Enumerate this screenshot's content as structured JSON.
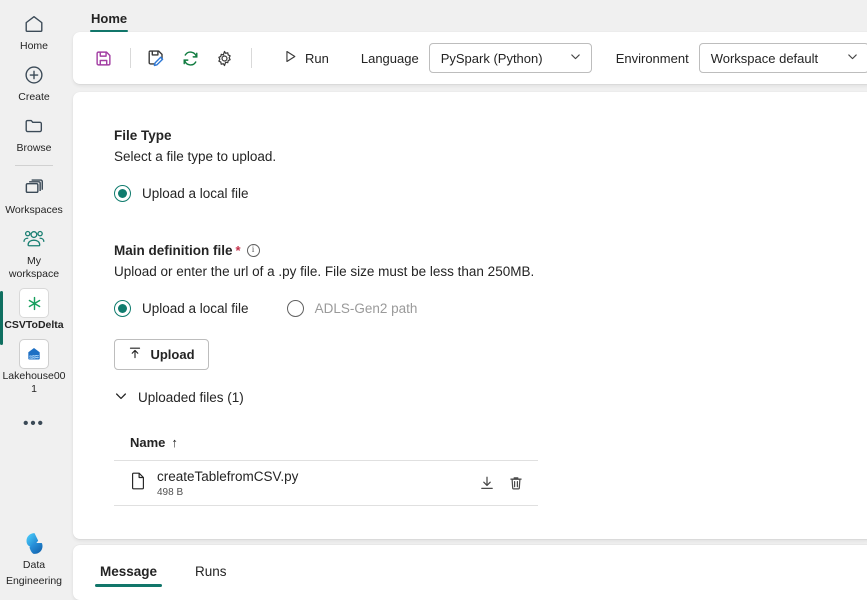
{
  "sidebar": {
    "items": [
      {
        "label": "Home",
        "icon": "home-icon"
      },
      {
        "label": "Create",
        "icon": "plus-circle-icon"
      },
      {
        "label": "Browse",
        "icon": "folder-icon"
      },
      {
        "label": "Workspaces",
        "icon": "workspaces-icon"
      },
      {
        "label": "My workspace",
        "icon": "people-icon"
      },
      {
        "label": "CSVToDelta",
        "icon": "spark-job-definition-icon"
      },
      {
        "label": "Lakehouse001",
        "icon": "lakehouse-icon"
      }
    ],
    "more_label": "•••",
    "brand": {
      "line1": "Data",
      "line2": "Engineering",
      "icon": "fabric-logo-icon"
    }
  },
  "top_tabs": [
    {
      "label": "Home",
      "active": true
    }
  ],
  "toolbar": {
    "icons": [
      {
        "name": "save-icon"
      },
      {
        "name": "save-as-icon"
      },
      {
        "name": "refresh-icon"
      },
      {
        "name": "settings-gear-icon"
      }
    ],
    "run_label": "Run",
    "run_icon": "play-icon",
    "language_label": "Language",
    "language_value": "PySpark (Python)",
    "environment_label": "Environment",
    "environment_value": "Workspace default"
  },
  "form": {
    "file_type": {
      "title": "File Type",
      "subtitle": "Select a file type to upload.",
      "options": [
        {
          "label": "Upload a local file",
          "selected": true,
          "disabled": false
        }
      ]
    },
    "main_definition_file": {
      "title": "Main definition file",
      "required_marker": "*",
      "info_glyph": "i",
      "subtitle": "Upload or enter the url of a .py file. File size must be less than 250MB.",
      "options": [
        {
          "label": "Upload a local file",
          "selected": true,
          "disabled": false
        },
        {
          "label": "ADLS-Gen2 path",
          "selected": false,
          "disabled": true
        }
      ],
      "upload_button": "Upload",
      "upload_icon": "upload-arrow-icon",
      "disclosure_label": "Uploaded files (1)",
      "disclosure_icon": "chevron-down-icon",
      "table": {
        "columns": [
          {
            "label": "Name",
            "sort": "↑"
          }
        ],
        "rows": [
          {
            "icon": "file-icon",
            "name": "createTablefromCSV.py",
            "size": "498 B",
            "actions": [
              "download-icon",
              "delete-icon"
            ]
          }
        ]
      }
    }
  },
  "bottom_tabs": [
    {
      "label": "Message",
      "active": true
    },
    {
      "label": "Runs",
      "active": false
    }
  ],
  "colors": {
    "accent_teal": "#11766a",
    "radio_green": "#107c6e",
    "required_red": "#c4314b",
    "save_purple": "#a33ea3",
    "refresh_green": "#0f7b3f",
    "edit_blue": "#2f79d6",
    "page_bg": "#f0f0f0",
    "card_bg": "#ffffff"
  }
}
